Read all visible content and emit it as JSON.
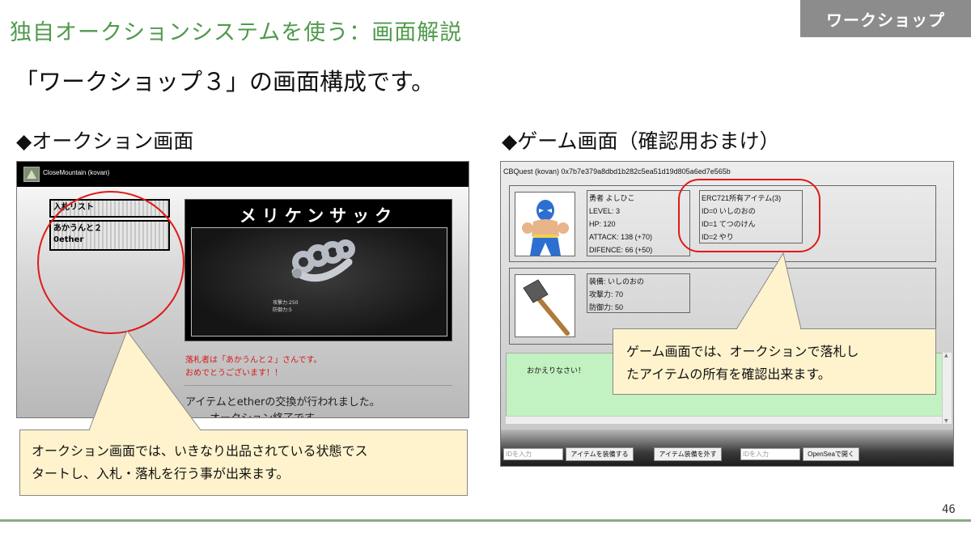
{
  "slide": {
    "title": "独自オークションシステムを使う：画面解説",
    "tag": "ワークショップ",
    "subtitle": "「ワークショップ３」の画面構成です。",
    "page_number": "46"
  },
  "sections": {
    "auction_heading": "◆オークション画面",
    "game_heading": "◆ゲーム画面（確認用おまけ）"
  },
  "auction": {
    "window_title": "CloseMountain (kovan)",
    "bid_list_label": "入札リスト",
    "current_bidder": "あかうんと２",
    "current_bid": "0ether",
    "item_name": "メリケンサック",
    "item_attack": "攻撃力:250",
    "item_defense": "防御力:5",
    "winner_line1": "落札者は「あかうんと２」さんです。",
    "winner_line2": "おめでとうございます！！",
    "exchange_msg": "アイテムとetherの交換が行われました。",
    "auction_end": "オークション終了です"
  },
  "game": {
    "header": "CBQuest (kovan) 0x7b7e379a8dbd1b282c5ea51d19d805a6ed7e565b",
    "status": {
      "name": "勇者 よしひこ",
      "level": "LEVEL: 3",
      "hp": "HP: 120",
      "attack": "ATTACK: 138 (+70)",
      "defense": "DIFENCE: 66 (+50)"
    },
    "items": {
      "title": "ERC721所有アイテム(3)",
      "item0": "ID=0 いしのおの",
      "item1": "ID=1 てつのけん",
      "item2": "ID=2 やり"
    },
    "equip": {
      "equipped": "装備: いしのおの",
      "attack": "攻撃力: 70",
      "defense": "防御力: 50"
    },
    "log_message": "おかえりなさい！",
    "controls": {
      "id_placeholder": "IDを入力",
      "equip_button": "アイテムを装備する",
      "unequip_button": "アイテム装備を外す",
      "id_placeholder2": "IDを入力",
      "opensea_button": "OpenSeaで開く"
    }
  },
  "callouts": {
    "left_line1": "オークション画面では、いきなり出品されている状態でス",
    "left_line2": "タートし、入札・落札を行う事が出来ます。",
    "right_line1": "ゲーム画面では、オークションで落札し",
    "right_line2": "たアイテムの所有を確認出来ます。"
  },
  "colors": {
    "title_green": "#4f9a4c",
    "tag_gray": "#8c8c8c",
    "callout_fill": "#fff3cd",
    "highlight_red": "#e01919",
    "log_green": "#c2f1c2",
    "footer_green": "#8aaa84"
  },
  "icons": {
    "auction_logo": "mountain-logo-icon",
    "item_image": "brass-knuckles-icon",
    "hero_image": "masked-wrestler-icon",
    "equip_image": "stone-axe-icon"
  }
}
